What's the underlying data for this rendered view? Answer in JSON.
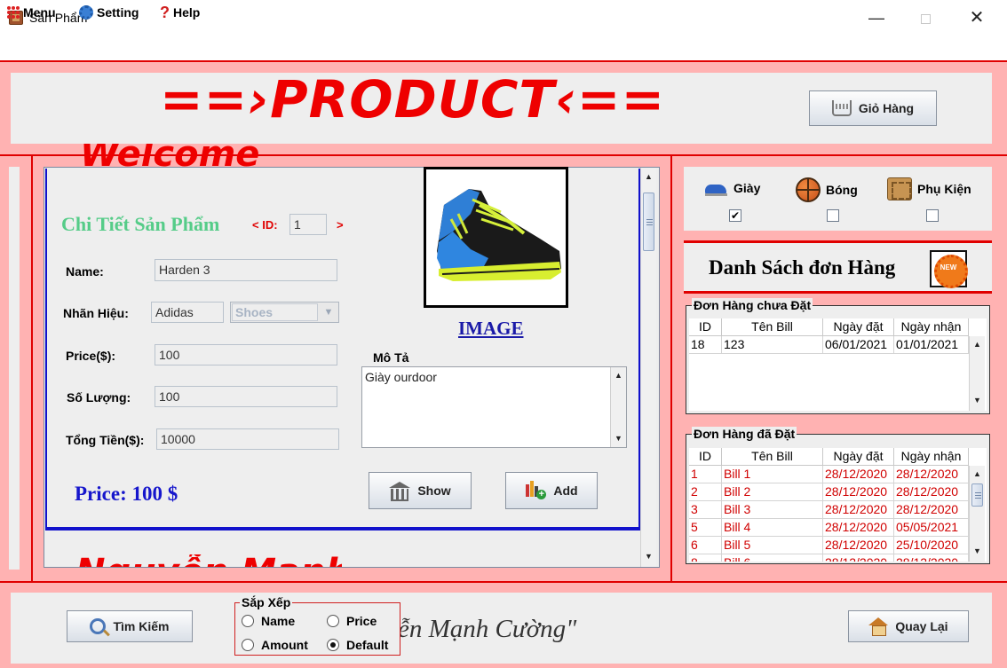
{
  "window": {
    "title": "Sản Phẩm",
    "min_glyph": "—",
    "close_glyph": "✕"
  },
  "menubar": {
    "menu": "Menu",
    "setting": "Setting",
    "help": "Help"
  },
  "header": {
    "banner": "==›PRODUCT‹==",
    "cart_button": "Giỏ Hàng"
  },
  "detail": {
    "heading_cut_top": "Welcome",
    "heading": "Chi Tiết Sản Phẩm",
    "id_label": "< ID:",
    "id_value": "1",
    "id_next": ">",
    "fields": {
      "name_label": "Name:",
      "name_value": "Harden 3",
      "brand_label": "Nhãn Hiệu:",
      "brand_value": "Adidas",
      "type_value": "Shoes",
      "price_label": "Price($):",
      "price_value": "100",
      "qty_label": "Số Lượng:",
      "qty_value": "100",
      "total_label": "Tổng Tiền($):",
      "total_value": "10000"
    },
    "price_display": "Price: 100 $",
    "image_label": "IMAGE",
    "desc_label": "Mô Tả",
    "desc_value": "Giày ourdoor",
    "show_button": "Show",
    "add_button": "Add",
    "heading_cut_bottom": "Nguyễn Mạnh"
  },
  "categories": [
    {
      "label": "Giày",
      "icon": "shoe-icon",
      "checked": true
    },
    {
      "label": "Bóng",
      "icon": "basketball-icon",
      "checked": false
    },
    {
      "label": "Phụ Kiện",
      "icon": "accessory-icon",
      "checked": false
    }
  ],
  "checkmark": "✔",
  "orders": {
    "title": "Danh Sách đơn Hàng",
    "badge": "NEW",
    "unplaced": {
      "title": "Đơn Hàng chưa Đặt",
      "columns": [
        "ID",
        "Tên Bill",
        "Ngày đặt",
        "Ngày nhận"
      ],
      "rows": [
        [
          "18",
          "123",
          "06/01/2021",
          "01/01/2021"
        ]
      ]
    },
    "placed": {
      "title": "Đơn Hàng đã Đặt",
      "columns": [
        "ID",
        "Tên Bill",
        "Ngày đặt",
        "Ngày nhận"
      ],
      "rows": [
        [
          "1",
          "Bill 1",
          "28/12/2020",
          "28/12/2020"
        ],
        [
          "2",
          "Bill 2",
          "28/12/2020",
          "28/12/2020"
        ],
        [
          "3",
          "Bill 3",
          "28/12/2020",
          "28/12/2020"
        ],
        [
          "5",
          "Bill 4",
          "28/12/2020",
          "05/05/2021"
        ],
        [
          "6",
          "Bill 5",
          "28/12/2020",
          "25/10/2020"
        ],
        [
          "8",
          "Bill 6",
          "28/12/2020",
          "28/12/2020"
        ]
      ]
    }
  },
  "footer": {
    "search_button": "Tìm Kiếm",
    "quote": "ễn Mạnh Cường\"",
    "back_button": "Quay Lại",
    "sort": {
      "title": "Sắp Xếp",
      "options": [
        {
          "label": "Name",
          "selected": false
        },
        {
          "label": "Price",
          "selected": false
        },
        {
          "label": "Amount",
          "selected": false
        },
        {
          "label": "Default",
          "selected": true
        }
      ]
    }
  },
  "colors": {
    "frame_pink": "#ffb2b2",
    "accent_red": "#e00000",
    "heading_green": "#55cc88",
    "price_blue": "#1616cc"
  }
}
